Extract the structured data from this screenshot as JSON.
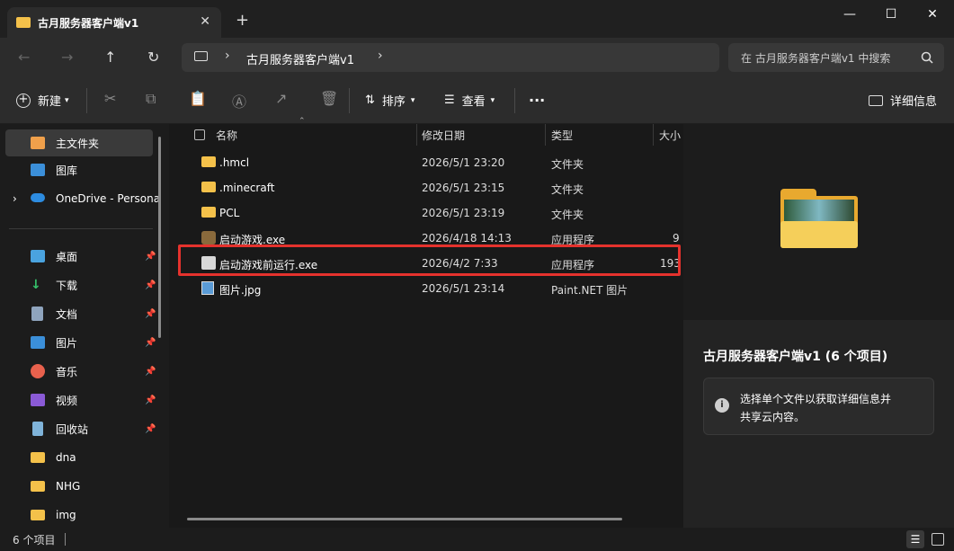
{
  "window": {
    "tab_title": "古月服务器客户端v1",
    "new_tab": "+",
    "close_tab": "✕",
    "minimize": "—",
    "maximize": "☐",
    "close": "✕"
  },
  "address": {
    "back": "←",
    "forward": "→",
    "up": "↑",
    "refresh": "↻",
    "path": "古月服务器客户端v1",
    "chevron": "›",
    "search_placeholder": "在 古月服务器客户端v1 中搜索"
  },
  "toolbar": {
    "new_label": "新建",
    "sort_label": "排序",
    "view_label": "查看",
    "more": "···",
    "details_label": "详细信息"
  },
  "sidebar": {
    "items": [
      {
        "label": "主文件夹",
        "icon": "home-icon"
      },
      {
        "label": "图库",
        "icon": "gallery-icon"
      },
      {
        "label": "OneDrive - Persona",
        "icon": "cloud-icon"
      },
      {
        "label": "桌面",
        "icon": "desktop-icon",
        "pinned": true
      },
      {
        "label": "下载",
        "icon": "download-icon",
        "pinned": true
      },
      {
        "label": "文档",
        "icon": "document-icon",
        "pinned": true
      },
      {
        "label": "图片",
        "icon": "picture-icon",
        "pinned": true
      },
      {
        "label": "音乐",
        "icon": "music-icon",
        "pinned": true
      },
      {
        "label": "视频",
        "icon": "video-icon",
        "pinned": true
      },
      {
        "label": "回收站",
        "icon": "recycle-bin-icon",
        "pinned": true
      },
      {
        "label": "dna",
        "icon": "folder-icon"
      },
      {
        "label": "NHG",
        "icon": "folder-icon"
      },
      {
        "label": "img",
        "icon": "folder-icon"
      }
    ]
  },
  "columns": {
    "name": "名称",
    "date": "修改日期",
    "type": "类型",
    "size": "大小"
  },
  "files": [
    {
      "name": ".hmcl",
      "date": "2026/5/1 23:20",
      "type": "文件夹",
      "size": ""
    },
    {
      "name": ".minecraft",
      "date": "2026/5/1 23:15",
      "type": "文件夹",
      "size": ""
    },
    {
      "name": "PCL",
      "date": "2026/5/1 23:19",
      "type": "文件夹",
      "size": ""
    },
    {
      "name": "启动游戏.exe",
      "date": "2026/4/18 14:13",
      "type": "应用程序",
      "size": "9"
    },
    {
      "name": "启动游戏前运行.exe",
      "date": "2026/4/2 7:33",
      "type": "应用程序",
      "size": "193"
    },
    {
      "name": "图片.jpg",
      "date": "2026/5/1 23:14",
      "type": "Paint.NET 图片",
      "size": ""
    }
  ],
  "highlight_color": "#e5322d",
  "preview": {
    "title": "古月服务器客户端v1 (6 个项目)",
    "info_line1": "选择单个文件以获取详细信息并",
    "info_line2": "共享云内容。",
    "info_icon": "i"
  },
  "status": {
    "count": "6 个项目"
  }
}
